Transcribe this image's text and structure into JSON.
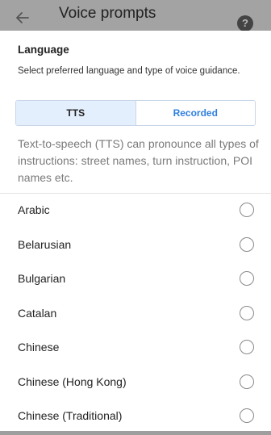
{
  "header": {
    "title": "Voice prompts",
    "back_icon": "arrow-left-icon",
    "help_icon": "help-circle-icon"
  },
  "language": {
    "heading": "Language",
    "subtext": "Select preferred language and type of voice guidance.",
    "tabs": [
      {
        "label": "TTS",
        "selected": true
      },
      {
        "label": "Recorded",
        "selected": false
      }
    ],
    "description": "Text-to-speech (TTS) can pronounce all types of instructions: street names, turn instruction, POI names etc."
  },
  "languages": [
    {
      "label": "Arabic",
      "selected": false
    },
    {
      "label": "Belarusian",
      "selected": false
    },
    {
      "label": "Bulgarian",
      "selected": false
    },
    {
      "label": "Catalan",
      "selected": false
    },
    {
      "label": "Chinese",
      "selected": false
    },
    {
      "label": "Chinese (Hong Kong)",
      "selected": false
    },
    {
      "label": "Chinese (Traditional)",
      "selected": false
    }
  ],
  "colors": {
    "accent": "#2f7fe0",
    "selected_tab_bg": "#e3effc"
  }
}
